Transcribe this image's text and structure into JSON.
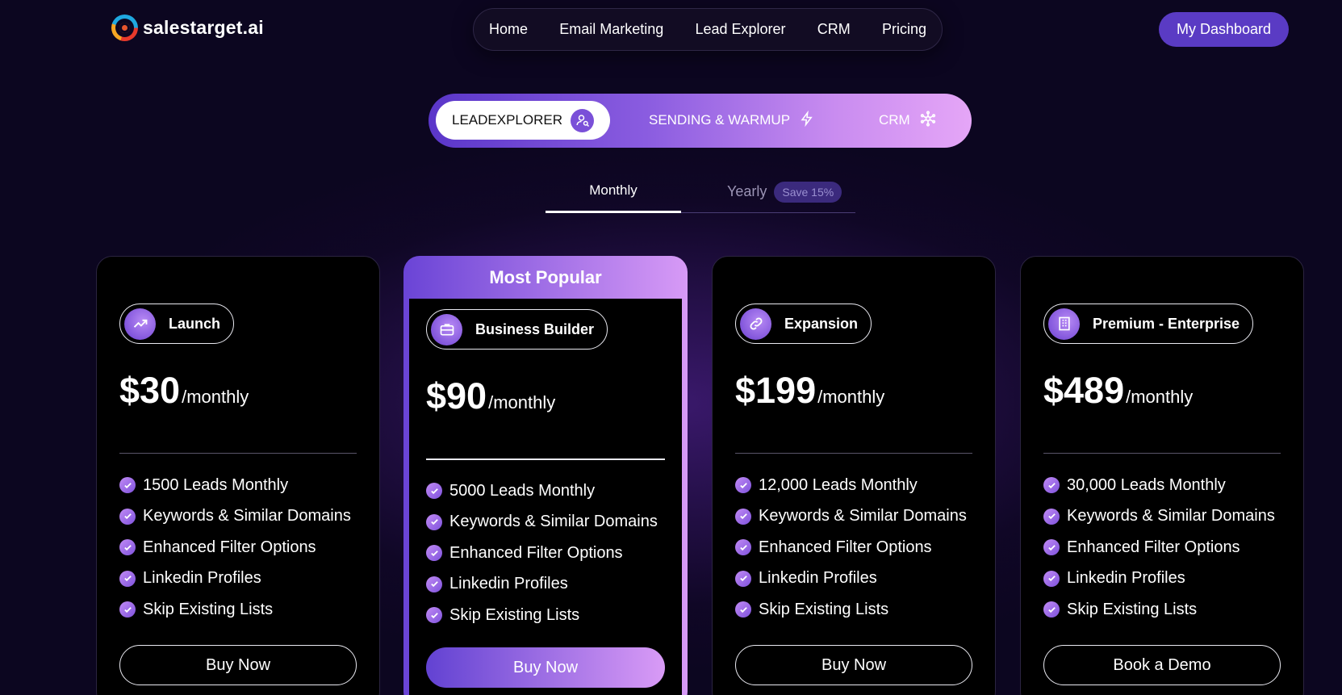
{
  "brand": {
    "name": "salestarget.ai"
  },
  "nav": {
    "items": [
      "Home",
      "Email Marketing",
      "Lead Explorer",
      "CRM",
      "Pricing"
    ]
  },
  "header": {
    "dashboard_label": "My Dashboard"
  },
  "products": {
    "active": "LEADEXPLORER",
    "items": [
      "LEADEXPLORER",
      "SENDING & WARMUP",
      "CRM"
    ]
  },
  "billing": {
    "monthly_label": "Monthly",
    "yearly_label": "Yearly",
    "save_badge": "Save 15%",
    "selected": "Monthly"
  },
  "plans": [
    {
      "name": "Launch",
      "icon": "trending-up-icon",
      "price": "$30",
      "period": "/monthly",
      "features": [
        "1500 Leads Monthly",
        "Keywords & Similar Domains",
        "Enhanced Filter Options",
        "Linkedin Profiles",
        "Skip Existing Lists"
      ],
      "cta": "Buy Now"
    },
    {
      "name": "Business Builder",
      "icon": "briefcase-icon",
      "price": "$90",
      "period": "/monthly",
      "badge": "Most Popular",
      "features": [
        "5000 Leads Monthly",
        "Keywords & Similar Domains",
        "Enhanced Filter Options",
        "Linkedin Profiles",
        "Skip Existing Lists"
      ],
      "cta": "Buy Now"
    },
    {
      "name": "Expansion",
      "icon": "link-icon",
      "price": "$199",
      "period": "/monthly",
      "features": [
        "12,000 Leads Monthly",
        "Keywords & Similar Domains",
        "Enhanced Filter Options",
        "Linkedin Profiles",
        "Skip Existing Lists"
      ],
      "cta": "Buy Now"
    },
    {
      "name": "Premium - Enterprise",
      "icon": "building-icon",
      "price": "$489",
      "period": "/monthly",
      "features": [
        "30,000 Leads Monthly",
        "Keywords & Similar Domains",
        "Enhanced Filter Options",
        "Linkedin Profiles",
        "Skip Existing Lists"
      ],
      "cta": "Book a Demo"
    }
  ],
  "colors": {
    "accent": "#5a3bc4",
    "gradient_start": "#6242d2",
    "gradient_end": "#d99bf6",
    "background": "#0c0620"
  }
}
